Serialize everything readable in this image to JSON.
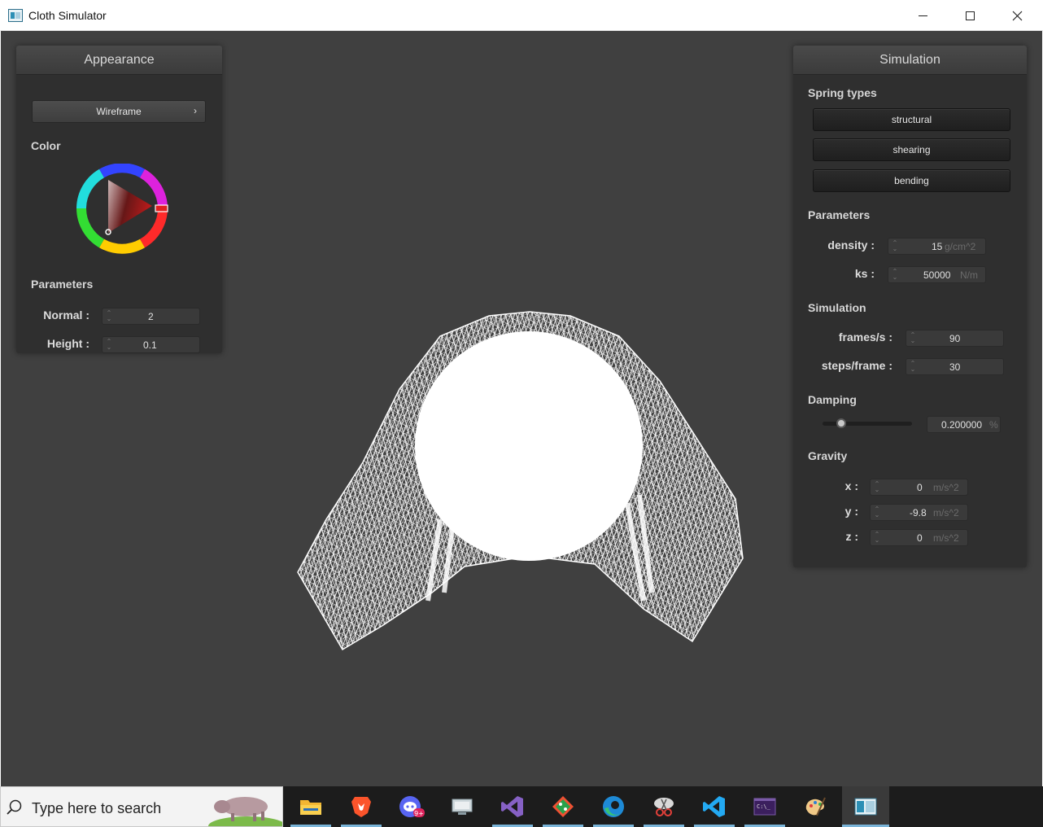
{
  "window": {
    "title": "Cloth Simulator"
  },
  "appearance": {
    "header": "Appearance",
    "shader_dropdown": "Wireframe",
    "color_label": "Color",
    "parameters_label": "Parameters",
    "normal": {
      "label": "Normal :",
      "value": "2"
    },
    "height": {
      "label": "Height :",
      "value": "0.1"
    },
    "color_value": "#e02020"
  },
  "simulation": {
    "header": "Simulation",
    "spring_types_label": "Spring types",
    "spring_types": [
      "structural",
      "shearing",
      "bending"
    ],
    "parameters_label": "Parameters",
    "density": {
      "label": "density :",
      "value": "15",
      "unit": "g/cm^2"
    },
    "ks": {
      "label": "ks :",
      "value": "50000",
      "unit": "N/m"
    },
    "simulation_label": "Simulation",
    "frames_per_s": {
      "label": "frames/s :",
      "value": "90"
    },
    "steps_per_frame": {
      "label": "steps/frame :",
      "value": "30"
    },
    "damping_label": "Damping",
    "damping": {
      "value": "0.200000",
      "unit": "%",
      "slider_fraction": 0.2
    },
    "gravity_label": "Gravity",
    "gravity_x": {
      "label": "x :",
      "value": "0",
      "unit": "m/s^2"
    },
    "gravity_y": {
      "label": "y :",
      "value": "-9.8",
      "unit": "m/s^2"
    },
    "gravity_z": {
      "label": "z :",
      "value": "0",
      "unit": "m/s^2"
    }
  },
  "taskbar": {
    "search_placeholder": "Type here to search",
    "apps": [
      "file-explorer-icon",
      "brave-browser-icon",
      "discord-icon",
      "remote-desktop-icon",
      "visual-studio-icon",
      "git-icon",
      "edge-browser-icon",
      "snipping-tool-icon",
      "vscode-icon",
      "terminal-icon",
      "paint-icon",
      "cloth-simulator-icon"
    ]
  }
}
